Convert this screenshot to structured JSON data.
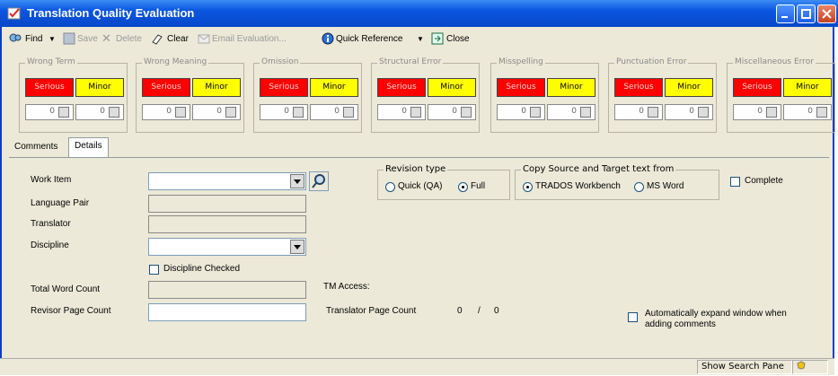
{
  "window": {
    "title": "Translation Quality Evaluation"
  },
  "toolbar": {
    "find": "Find",
    "save": "Save",
    "delete": "Delete",
    "clear": "Clear",
    "email": "Email Evaluation...",
    "quick_reference": "Quick Reference",
    "close": "Close"
  },
  "error_groups": [
    {
      "label": "Wrong Term",
      "serious": "Serious",
      "minor": "Minor",
      "serious_count": "0",
      "minor_count": "0"
    },
    {
      "label": "Wrong Meaning",
      "serious": "Serious",
      "minor": "Minor",
      "serious_count": "0",
      "minor_count": "0"
    },
    {
      "label": "Omission",
      "serious": "Serious",
      "minor": "Minor",
      "serious_count": "0",
      "minor_count": "0"
    },
    {
      "label": "Structural Error",
      "serious": "Serious",
      "minor": "Minor",
      "serious_count": "0",
      "minor_count": "0"
    },
    {
      "label": "Misspelling",
      "serious": "Serious",
      "minor": "Minor",
      "serious_count": "0",
      "minor_count": "0"
    },
    {
      "label": "Punctuation Error",
      "serious": "Serious",
      "minor": "Minor",
      "serious_count": "0",
      "minor_count": "0"
    },
    {
      "label": "Miscellaneous Error",
      "serious": "Serious",
      "minor": "Minor",
      "serious_count": "0",
      "minor_count": "0"
    }
  ],
  "tabs": {
    "comments": "Comments",
    "details": "Details"
  },
  "details": {
    "work_item": "Work Item",
    "language_pair": "Language Pair",
    "translator": "Translator",
    "discipline": "Discipline",
    "discipline_checked": "Discipline Checked",
    "total_word_count": "Total Word Count",
    "revisor_page_count": "Revisor Page Count",
    "revision_type": {
      "title": "Revision type",
      "quick": "Quick (QA)",
      "full": "Full",
      "selected": "Full"
    },
    "copy_source": {
      "title": "Copy Source and Target text from",
      "trados": "TRADOS Workbench",
      "msword": "MS Word",
      "selected": "TRADOS Workbench"
    },
    "complete": "Complete",
    "tm_access": "TM Access:",
    "translator_page_count": "Translator Page Count",
    "tpc_value1": "0",
    "tpc_sep": "/",
    "tpc_value2": "0",
    "auto_expand_line1": "Automatically expand window when",
    "auto_expand_line2": "adding comments"
  },
  "statusbar": {
    "show_search_pane": "Show Search Pane"
  },
  "colors": {
    "serious": "#ff0000",
    "minor": "#ffff00",
    "titlebar": "#0a55e0"
  }
}
